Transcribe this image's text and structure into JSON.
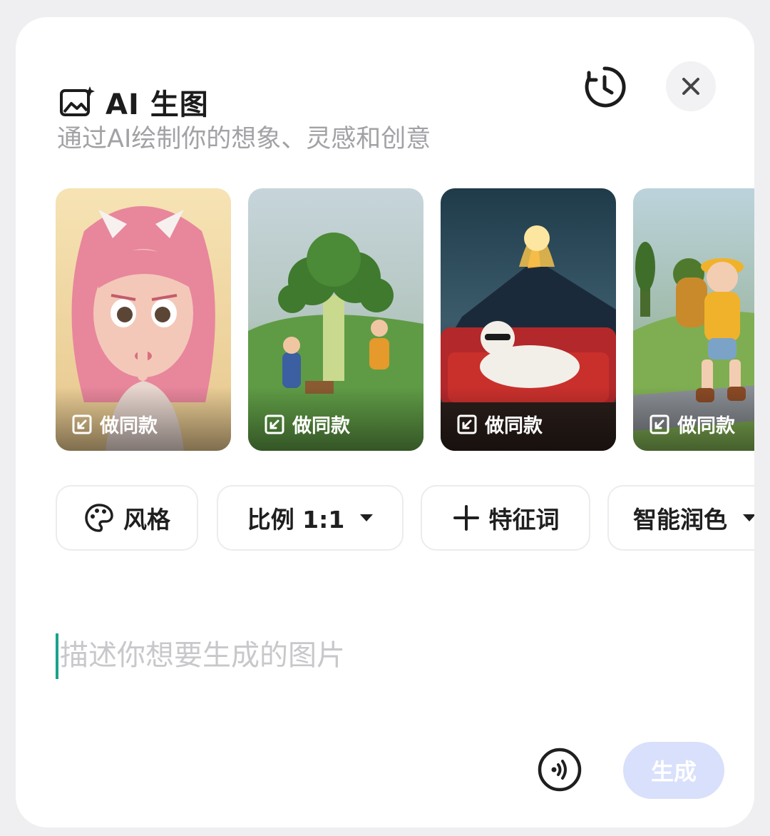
{
  "header": {
    "title": "AI 生图",
    "subtitle": "通过AI绘制你的想象、灵感和创意",
    "title_icon": "image-sparkle-icon",
    "history_icon": "history-clock-icon",
    "close_icon": "close-icon"
  },
  "templates": {
    "action_label": "做同款",
    "action_icon": "arrow-in-box-icon",
    "items": [
      {
        "id": "pink-hair-girl",
        "theme": "pink-haired 3D girl portrait",
        "colors": [
          "#f2d79e",
          "#e98aa2"
        ]
      },
      {
        "id": "broccoli-tree",
        "theme": "broccoli tree with tiny people",
        "colors": [
          "#b9cbd2",
          "#4f8a3c"
        ]
      },
      {
        "id": "volcano-cat",
        "theme": "cat on red sofa with erupting volcano",
        "colors": [
          "#2c4a5a",
          "#b02a25"
        ]
      },
      {
        "id": "hiker-girl",
        "theme": "3D girl hiker with yellow hat",
        "colors": [
          "#a8c3cf",
          "#e9b23a"
        ]
      }
    ]
  },
  "options": {
    "style": {
      "label": "风格",
      "icon": "palette-icon"
    },
    "ratio": {
      "label": "比例 1:1",
      "icon": "caret-down-icon"
    },
    "keywords": {
      "label": "特征词",
      "icon": "plus-icon"
    },
    "enhance": {
      "label": "智能润色",
      "icon": "caret-down-icon"
    }
  },
  "prompt": {
    "placeholder": "描述你想要生成的图片",
    "value": ""
  },
  "actions": {
    "voice_icon": "voice-input-icon",
    "generate_label": "生成"
  },
  "colors": {
    "accent_disabled": "#d9e0fb",
    "cursor": "#19a38a",
    "subtitle": "#a2a2a6"
  }
}
